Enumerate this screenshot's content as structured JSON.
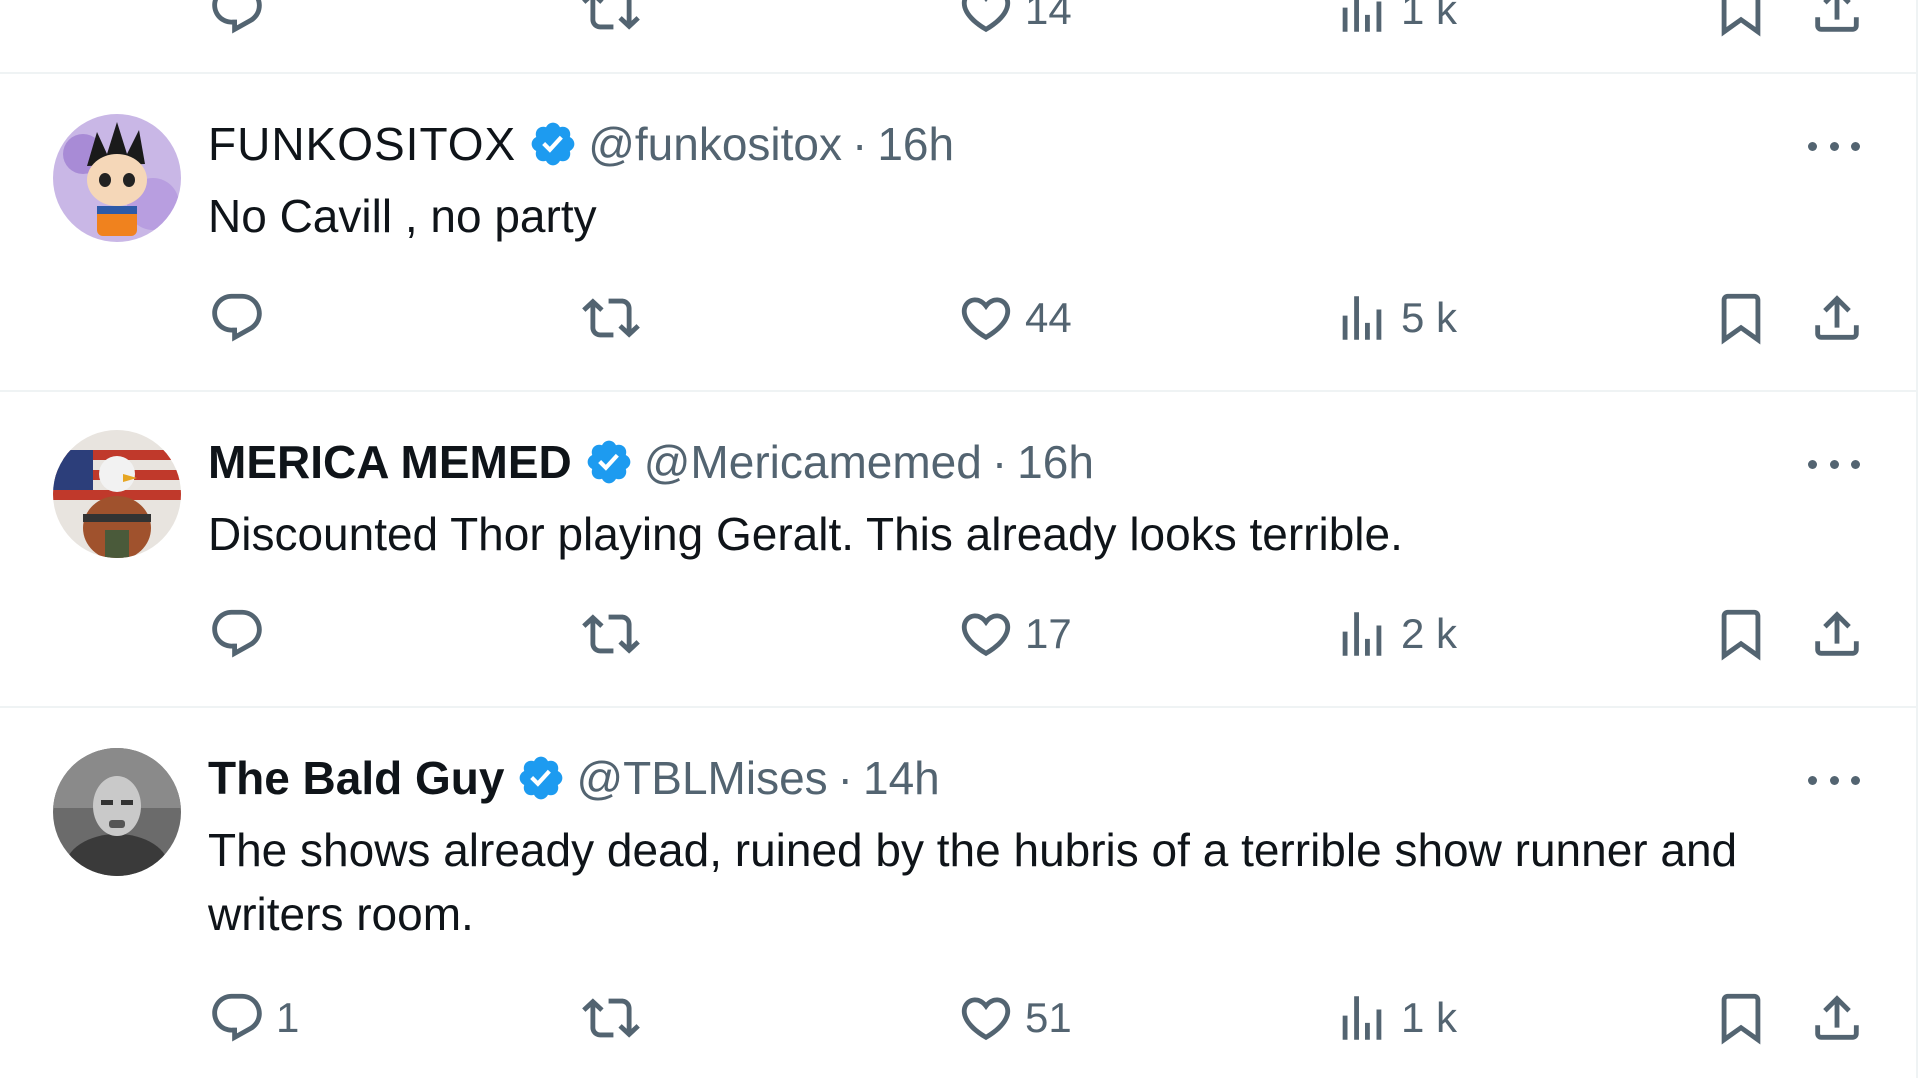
{
  "colors": {
    "text": "#0f1419",
    "secondary": "#536471",
    "verified": "#1d9bf0",
    "divider": "#eff3f4"
  },
  "top_partial": {
    "like_count": "14",
    "views_count": "1 k"
  },
  "tweets": [
    {
      "avatar": "goku-funko-avatar",
      "display_name": "FUNKOSITOX",
      "handle": "@funkositox",
      "separator": "·",
      "time": "16h",
      "text": "No Cavill , no party",
      "reply_count": "",
      "like_count": "44",
      "views_count": "5 k"
    },
    {
      "avatar": "eagle-soldier-flag-avatar",
      "display_name": "MERICA MEMED",
      "handle": "@Mericamemed",
      "separator": "·",
      "time": "16h",
      "text": "Discounted Thor playing Geralt. This already looks terrible.",
      "reply_count": "",
      "like_count": "17",
      "views_count": "2 k"
    },
    {
      "avatar": "bald-man-photo-avatar",
      "display_name": "The Bald Guy",
      "handle": "@TBLMises",
      "separator": "·",
      "time": "14h",
      "text": "The shows already dead, ruined by the hubris of a terrible show runner and writers room.",
      "reply_count": "1",
      "like_count": "51",
      "views_count": "1 k"
    }
  ]
}
